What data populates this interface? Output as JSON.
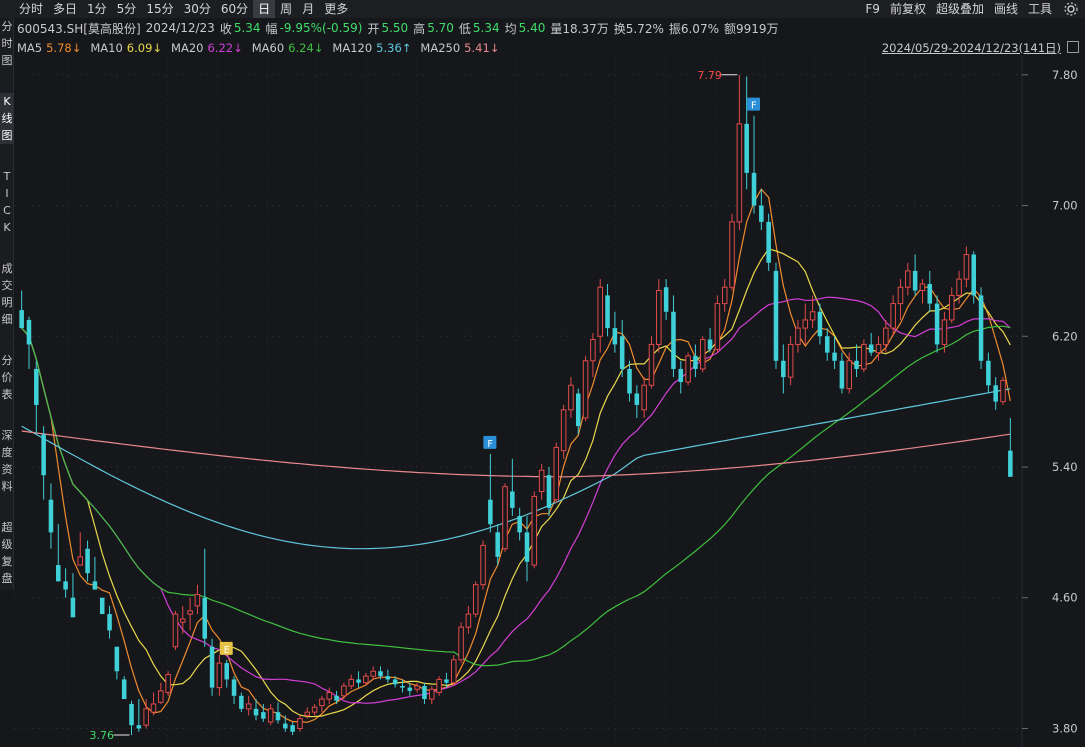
{
  "toolbar": {
    "items": [
      "分时",
      "多日",
      "1分",
      "5分",
      "15分",
      "30分",
      "60分",
      "日",
      "周",
      "月",
      "更多"
    ],
    "active": "日",
    "right_items": [
      "F9",
      "前复权",
      "超级叠加",
      "画线",
      "工具"
    ]
  },
  "sidebar": {
    "items": [
      {
        "label": "分时图",
        "chars": [
          "分",
          "时",
          "图"
        ]
      },
      {
        "label": "K线图",
        "chars": [
          "K",
          "线",
          "图"
        ]
      },
      {
        "label": "TICK",
        "chars": [
          "T",
          "I",
          "C",
          "K"
        ]
      },
      {
        "label": "成交明细",
        "chars": [
          "成",
          "交",
          "明",
          "细"
        ]
      },
      {
        "label": "分价表",
        "chars": [
          "分",
          "价",
          "表"
        ]
      },
      {
        "label": "深度资料",
        "chars": [
          "深",
          "度",
          "资",
          "料"
        ]
      },
      {
        "label": "超级复盘",
        "chars": [
          "超",
          "级",
          "复",
          "盘"
        ]
      }
    ],
    "active_index": 1
  },
  "stock": {
    "code_name": "600543.SH[莫高股份]",
    "date": "2024/12/23",
    "close_label": "收",
    "close": "5.34",
    "change_label": "幅",
    "change": "-9.95%(-0.59)",
    "open_label": "开",
    "open": "5.50",
    "high_label": "高",
    "high": "5.70",
    "low_label": "低",
    "low": "5.34",
    "avg_label": "均",
    "avg": "5.40",
    "volume": "量18.37万",
    "turnover": "换5.72%",
    "amplitude": "振6.07%",
    "amount": "额9919万"
  },
  "ma": [
    {
      "label": "MA5",
      "value": "5.78↓",
      "color": "#f08c2e"
    },
    {
      "label": "MA10",
      "value": "6.09↓",
      "color": "#e8d84a"
    },
    {
      "label": "MA20",
      "value": "6.22↓",
      "color": "#d23fd6"
    },
    {
      "label": "MA60",
      "value": "6.24↓",
      "color": "#3fbf3f"
    },
    {
      "label": "MA120",
      "value": "5.36↑",
      "color": "#5fc8dc"
    },
    {
      "label": "MA250",
      "value": "5.41↓",
      "color": "#e8898c"
    }
  ],
  "date_range": "2024/05/29-2024/12/23(141日)",
  "colors": {
    "up": "#e04a4a",
    "down": "#3fd0d8",
    "bg": "#16171b",
    "axis_text": "#c8c9cc",
    "label_white": "#e6e6e6",
    "label_red": "#ff4d4d",
    "label_green": "#3fdc6a"
  },
  "annotations": {
    "high_label": "7.79",
    "low_label": "3.76",
    "markers": [
      {
        "text": "F",
        "color": "#2a8fd6"
      },
      {
        "text": "E",
        "color": "#e6c244"
      },
      {
        "text": "F",
        "color": "#2a8fd6"
      }
    ]
  },
  "chart_data": {
    "type": "candlestick",
    "y_axis": {
      "ticks": [
        "7.80",
        "7.00",
        "6.20",
        "5.40",
        "4.60",
        "3.80"
      ],
      "ylim": [
        3.76,
        7.86
      ]
    },
    "candles": [
      [
        6.36,
        6.48,
        6.3,
        6.25
      ],
      [
        6.3,
        6.32,
        6.0,
        6.15
      ],
      [
        6.0,
        6.05,
        5.6,
        5.78
      ],
      [
        5.6,
        5.65,
        5.2,
        5.35
      ],
      [
        5.2,
        5.3,
        4.9,
        5.0
      ],
      [
        4.8,
        5.05,
        4.75,
        4.7
      ],
      [
        4.7,
        4.78,
        4.6,
        4.65
      ],
      [
        4.6,
        4.75,
        4.55,
        4.48
      ],
      [
        4.8,
        5.0,
        4.8,
        4.85
      ],
      [
        4.9,
        4.95,
        4.7,
        4.75
      ],
      [
        4.7,
        4.85,
        4.65,
        4.65
      ],
      [
        4.6,
        4.6,
        4.5,
        4.5
      ],
      [
        4.5,
        4.55,
        4.35,
        4.4
      ],
      [
        4.3,
        4.3,
        4.1,
        4.15
      ],
      [
        4.1,
        4.12,
        4.0,
        3.98
      ],
      [
        3.95,
        3.97,
        3.76,
        3.82
      ],
      [
        3.82,
        3.98,
        3.78,
        3.8
      ],
      [
        3.82,
        3.98,
        3.8,
        3.92
      ],
      [
        3.9,
        4.02,
        3.88,
        3.95
      ],
      [
        3.96,
        4.08,
        3.95,
        4.03
      ],
      [
        4.02,
        4.15,
        4.0,
        4.13
      ],
      [
        4.3,
        4.52,
        4.28,
        4.5
      ],
      [
        4.45,
        4.55,
        4.38,
        4.47
      ],
      [
        4.5,
        4.6,
        4.4,
        4.52
      ],
      [
        4.55,
        4.68,
        4.5,
        4.62
      ],
      [
        4.6,
        4.9,
        4.3,
        4.35
      ],
      [
        4.3,
        4.35,
        4.0,
        4.05
      ],
      [
        4.05,
        4.25,
        4.0,
        4.2
      ],
      [
        4.2,
        4.22,
        4.05,
        4.1
      ],
      [
        4.1,
        4.12,
        3.95,
        4.0
      ],
      [
        4.0,
        4.02,
        3.9,
        3.92
      ],
      [
        3.92,
        4.0,
        3.88,
        3.95
      ],
      [
        3.92,
        3.98,
        3.85,
        3.88
      ],
      [
        3.9,
        3.95,
        3.84,
        3.86
      ],
      [
        3.84,
        3.95,
        3.82,
        3.92
      ],
      [
        3.9,
        3.96,
        3.83,
        3.85
      ],
      [
        3.83,
        3.88,
        3.78,
        3.8
      ],
      [
        3.82,
        3.84,
        3.76,
        3.78
      ],
      [
        3.8,
        3.88,
        3.78,
        3.86
      ],
      [
        3.88,
        3.93,
        3.86,
        3.9
      ],
      [
        3.9,
        3.95,
        3.88,
        3.93
      ],
      [
        3.94,
        4.0,
        3.9,
        3.98
      ],
      [
        3.98,
        4.05,
        3.95,
        4.02
      ],
      [
        4.0,
        4.03,
        3.95,
        3.97
      ],
      [
        4.0,
        4.08,
        3.98,
        4.06
      ],
      [
        4.06,
        4.13,
        4.04,
        4.1
      ],
      [
        4.1,
        4.15,
        4.05,
        4.08
      ],
      [
        4.08,
        4.14,
        4.06,
        4.12
      ],
      [
        4.12,
        4.18,
        4.1,
        4.15
      ],
      [
        4.15,
        4.18,
        4.1,
        4.12
      ],
      [
        4.12,
        4.16,
        4.08,
        4.1
      ],
      [
        4.1,
        4.12,
        4.05,
        4.07
      ],
      [
        4.06,
        4.1,
        4.02,
        4.05
      ],
      [
        4.05,
        4.08,
        4.0,
        4.03
      ],
      [
        4.04,
        4.08,
        4.02,
        4.06
      ],
      [
        4.06,
        4.08,
        3.95,
        3.98
      ],
      [
        3.98,
        4.06,
        3.95,
        4.04
      ],
      [
        4.02,
        4.12,
        4.0,
        4.1
      ],
      [
        4.1,
        4.14,
        4.05,
        4.08
      ],
      [
        4.08,
        4.25,
        4.06,
        4.22
      ],
      [
        4.22,
        4.45,
        4.2,
        4.42
      ],
      [
        4.42,
        4.55,
        4.38,
        4.5
      ],
      [
        4.5,
        4.7,
        4.48,
        4.68
      ],
      [
        4.68,
        4.95,
        4.65,
        4.92
      ],
      [
        5.2,
        5.48,
        5.0,
        5.05
      ],
      [
        5.0,
        5.05,
        4.8,
        4.85
      ],
      [
        4.9,
        5.3,
        4.88,
        5.28
      ],
      [
        5.25,
        5.45,
        5.1,
        5.15
      ],
      [
        5.1,
        5.15,
        4.95,
        5.0
      ],
      [
        5.0,
        5.1,
        4.7,
        4.82
      ],
      [
        4.8,
        5.25,
        4.78,
        5.22
      ],
      [
        5.25,
        5.42,
        5.2,
        5.38
      ],
      [
        5.35,
        5.4,
        5.1,
        5.15
      ],
      [
        5.2,
        5.55,
        5.18,
        5.52
      ],
      [
        5.5,
        5.78,
        5.45,
        5.75
      ],
      [
        5.75,
        5.95,
        5.7,
        5.9
      ],
      [
        5.85,
        5.88,
        5.6,
        5.65
      ],
      [
        5.7,
        6.08,
        5.68,
        6.05
      ],
      [
        6.05,
        6.22,
        5.95,
        6.18
      ],
      [
        6.2,
        6.55,
        6.1,
        6.5
      ],
      [
        6.45,
        6.52,
        6.2,
        6.25
      ],
      [
        6.25,
        6.35,
        6.1,
        6.15
      ],
      [
        6.2,
        6.3,
        5.95,
        6.0
      ],
      [
        6.0,
        6.05,
        5.8,
        5.85
      ],
      [
        5.85,
        5.9,
        5.7,
        5.78
      ],
      [
        5.75,
        5.95,
        5.7,
        5.9
      ],
      [
        5.9,
        6.2,
        5.88,
        6.15
      ],
      [
        6.15,
        6.55,
        6.1,
        6.48
      ],
      [
        6.5,
        6.55,
        6.3,
        6.35
      ],
      [
        6.35,
        6.45,
        5.95,
        6.0
      ],
      [
        6.0,
        6.05,
        5.85,
        5.92
      ],
      [
        5.92,
        6.1,
        5.9,
        6.08
      ],
      [
        6.08,
        6.15,
        5.95,
        6.0
      ],
      [
        6.0,
        6.2,
        5.98,
        6.18
      ],
      [
        6.18,
        6.25,
        6.1,
        6.12
      ],
      [
        6.12,
        6.45,
        6.1,
        6.4
      ],
      [
        6.4,
        6.55,
        6.35,
        6.5
      ],
      [
        6.5,
        6.95,
        6.48,
        6.9
      ],
      [
        6.9,
        7.8,
        6.85,
        7.5
      ],
      [
        7.5,
        7.79,
        7.1,
        7.2
      ],
      [
        7.2,
        7.55,
        6.95,
        7.0
      ],
      [
        7.0,
        7.1,
        6.85,
        6.9
      ],
      [
        6.9,
        6.95,
        6.6,
        6.65
      ],
      [
        6.6,
        6.65,
        6.0,
        6.05
      ],
      [
        6.05,
        6.15,
        5.85,
        5.95
      ],
      [
        5.95,
        6.2,
        5.9,
        6.15
      ],
      [
        6.15,
        6.3,
        6.1,
        6.25
      ],
      [
        6.25,
        6.4,
        6.15,
        6.3
      ],
      [
        6.3,
        6.45,
        6.25,
        6.35
      ],
      [
        6.35,
        6.4,
        6.15,
        6.2
      ],
      [
        6.2,
        6.25,
        6.05,
        6.1
      ],
      [
        6.1,
        6.2,
        6.0,
        6.05
      ],
      [
        6.05,
        6.1,
        5.85,
        5.88
      ],
      [
        5.88,
        6.1,
        5.85,
        6.05
      ],
      [
        6.05,
        6.15,
        5.95,
        6.0
      ],
      [
        6.0,
        6.18,
        5.98,
        6.15
      ],
      [
        6.15,
        6.22,
        6.08,
        6.1
      ],
      [
        6.1,
        6.2,
        6.05,
        6.15
      ],
      [
        6.15,
        6.3,
        6.1,
        6.25
      ],
      [
        6.25,
        6.45,
        6.2,
        6.4
      ],
      [
        6.4,
        6.55,
        6.3,
        6.5
      ],
      [
        6.5,
        6.65,
        6.45,
        6.6
      ],
      [
        6.6,
        6.7,
        6.45,
        6.48
      ],
      [
        6.48,
        6.55,
        6.4,
        6.52
      ],
      [
        6.52,
        6.6,
        6.35,
        6.4
      ],
      [
        6.4,
        6.45,
        6.1,
        6.15
      ],
      [
        6.15,
        6.35,
        6.1,
        6.3
      ],
      [
        6.3,
        6.5,
        6.28,
        6.45
      ],
      [
        6.45,
        6.6,
        6.4,
        6.55
      ],
      [
        6.55,
        6.75,
        6.5,
        6.7
      ],
      [
        6.7,
        6.72,
        6.4,
        6.45
      ],
      [
        6.45,
        6.5,
        6.0,
        6.05
      ],
      [
        6.05,
        6.1,
        5.85,
        5.9
      ],
      [
        5.9,
        5.95,
        5.75,
        5.8
      ],
      [
        5.8,
        5.95,
        5.78,
        5.93
      ],
      [
        5.5,
        5.7,
        5.34,
        5.34
      ]
    ]
  }
}
